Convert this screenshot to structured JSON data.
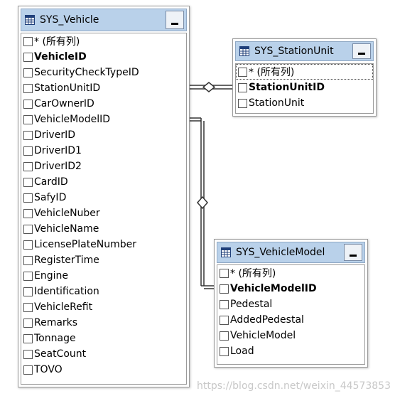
{
  "tables": {
    "vehicle": {
      "title": "SYS_Vehicle",
      "columns": [
        {
          "label": "* (所有列)",
          "bold": false
        },
        {
          "label": "VehicleID",
          "bold": true
        },
        {
          "label": "SecurityCheckTypeID",
          "bold": false
        },
        {
          "label": "StationUnitID",
          "bold": false
        },
        {
          "label": "CarOwnerID",
          "bold": false
        },
        {
          "label": "VehicleModelID",
          "bold": false
        },
        {
          "label": "DriverID",
          "bold": false
        },
        {
          "label": "DriverID1",
          "bold": false
        },
        {
          "label": "DriverID2",
          "bold": false
        },
        {
          "label": "CardID",
          "bold": false
        },
        {
          "label": "SafyID",
          "bold": false
        },
        {
          "label": "VehicleNuber",
          "bold": false
        },
        {
          "label": "VehicleName",
          "bold": false
        },
        {
          "label": "LicensePlateNumber",
          "bold": false
        },
        {
          "label": "RegisterTime",
          "bold": false
        },
        {
          "label": "Engine",
          "bold": false
        },
        {
          "label": "Identification",
          "bold": false
        },
        {
          "label": "VehicleRefit",
          "bold": false
        },
        {
          "label": "Remarks",
          "bold": false
        },
        {
          "label": "Tonnage",
          "bold": false
        },
        {
          "label": "SeatCount",
          "bold": false
        },
        {
          "label": "TOVO",
          "bold": false
        }
      ]
    },
    "station_unit": {
      "title": "SYS_StationUnit",
      "columns": [
        {
          "label": "* (所有列)",
          "bold": false,
          "selected": true
        },
        {
          "label": "StationUnitID",
          "bold": true
        },
        {
          "label": "StationUnit",
          "bold": false
        }
      ]
    },
    "vehicle_model": {
      "title": "SYS_VehicleModel",
      "columns": [
        {
          "label": "* (所有列)",
          "bold": false
        },
        {
          "label": "VehicleModelID",
          "bold": true
        },
        {
          "label": "Pedestal",
          "bold": false
        },
        {
          "label": "AddedPedestal",
          "bold": false
        },
        {
          "label": "VehicleModel",
          "bold": false
        },
        {
          "label": "Load",
          "bold": false
        }
      ]
    }
  },
  "watermark": "https://blog.csdn.net/weixin_44573853",
  "colors": {
    "title_bar": "#b9d1ea",
    "relationship_line": "#333333"
  },
  "icons": {
    "table": "table-grid-icon",
    "minimize": "minimize-icon",
    "checkbox": "checkbox-icon",
    "relationship": "diamond-icon"
  }
}
